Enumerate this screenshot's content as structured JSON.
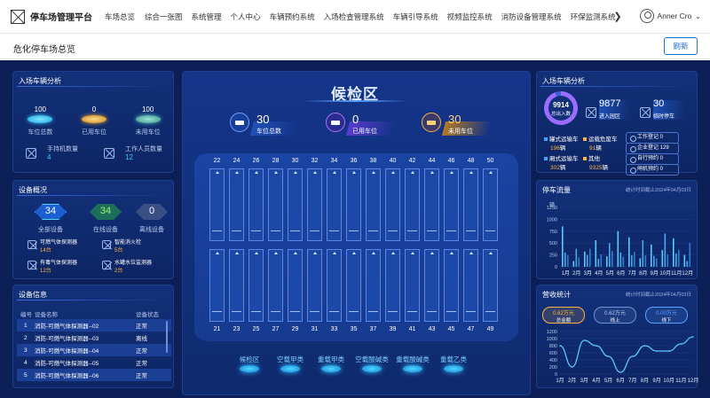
{
  "app_title": "停车场管理平台",
  "nav": [
    "车场总览",
    "综合一张图",
    "系统管理",
    "个人中心",
    "车辆预约系统",
    "入场检查管理系统",
    "车辆引导系统",
    "视频监控系统",
    "消防设备管理系统",
    "环保监测系统"
  ],
  "nav_more": "❯",
  "user": {
    "name": "Anner Cro",
    "dropdown": "⌄"
  },
  "page_title": "危化停车场总览",
  "refresh_label": "刷新",
  "entry_left": {
    "title": "入场车辆分析",
    "stats": [
      {
        "value": "100",
        "label": "车位总数"
      },
      {
        "value": "0",
        "label": "已用车位"
      },
      {
        "value": "100",
        "label": "未用车位"
      }
    ],
    "cards": [
      {
        "label": "手持机数量",
        "value": "4"
      },
      {
        "label": "工作人员数量",
        "value": "12"
      }
    ]
  },
  "equip": {
    "title": "设备概况",
    "stats": [
      {
        "value": "34",
        "label": "全部设备"
      },
      {
        "value": "34",
        "label": "在线设备"
      },
      {
        "value": "0",
        "label": "离线设备"
      }
    ],
    "items": [
      {
        "name": "可燃气体探测器",
        "count": "14台"
      },
      {
        "name": "智能消火栓",
        "count": "5台"
      },
      {
        "name": "有毒气体探测器",
        "count": "12台"
      },
      {
        "name": "水罐水位监测器",
        "count": "2台"
      }
    ]
  },
  "devinfo": {
    "title": "设备信息",
    "headers": [
      "编号",
      "设备名称",
      "设备状态"
    ],
    "rows": [
      [
        "1",
        "消防-可燃气体探测器--02",
        "正常"
      ],
      [
        "2",
        "消防-可燃气体探测器--03",
        "离线"
      ],
      [
        "3",
        "消防-可燃气体探测器--04",
        "正常"
      ],
      [
        "4",
        "消防-可燃气体探测器--05",
        "正常"
      ],
      [
        "5",
        "消防-可燃气体探测器--06",
        "正常"
      ]
    ]
  },
  "center": {
    "title": "候检区",
    "stats": [
      {
        "value": "30",
        "label": "车位总数"
      },
      {
        "value": "0",
        "label": "已用车位"
      },
      {
        "value": "30",
        "label": "未用车位"
      }
    ],
    "top_numbers": [
      "22",
      "24",
      "26",
      "28",
      "30",
      "32",
      "34",
      "36",
      "38",
      "40",
      "42",
      "44",
      "46",
      "48",
      "50"
    ],
    "bottom_numbers": [
      "21",
      "23",
      "25",
      "27",
      "29",
      "31",
      "33",
      "35",
      "37",
      "39",
      "41",
      "43",
      "45",
      "47",
      "49"
    ],
    "zones": [
      "候检区",
      "空载甲类",
      "重载甲类",
      "空载酸碱类",
      "重载酸碱类",
      "重载乙类"
    ]
  },
  "entry_right": {
    "title": "入场车辆分析",
    "total": "9914",
    "total_label": "总出入数",
    "in": "9877",
    "in_label": "进入园区",
    "temp": "30",
    "temp_label": "临时停车",
    "legend": [
      {
        "name": "罐式运输车",
        "value": "196",
        "unit": "辆"
      },
      {
        "name": "运载危废车",
        "value": "91",
        "unit": "辆"
      },
      {
        "name": "厢式运输车",
        "value": "302",
        "unit": "辆"
      },
      {
        "name": "其他",
        "value": "9325",
        "unit": "辆"
      }
    ],
    "pills": [
      "工作登记 0",
      "企业登记 129",
      "自行预约 0",
      "闸机预约 0"
    ]
  },
  "flow": {
    "title": "停车流量",
    "note": "统计时间截止2024年04月03日",
    "unit": "辆",
    "yticks": [
      "1250",
      "1000",
      "750",
      "500",
      "250",
      "0"
    ],
    "months": [
      "1月",
      "2月",
      "3月",
      "4月",
      "5月",
      "6月",
      "7月",
      "8月",
      "9月",
      "10月",
      "11月",
      "12月"
    ]
  },
  "revenue": {
    "title": "营收统计",
    "note": "统计时间截止2024年04月03日",
    "pills": [
      {
        "value": "0.62万元",
        "label": "总金额"
      },
      {
        "value": "0.62万元",
        "label": "线上"
      },
      {
        "value": "0.00万元",
        "label": "线下"
      }
    ],
    "yticks": [
      "1200",
      "1000",
      "800",
      "600",
      "400",
      "200",
      "0"
    ],
    "months": [
      "1月",
      "2月",
      "3月",
      "4月",
      "5月",
      "6月",
      "7月",
      "8月",
      "9月",
      "10月",
      "11月",
      "12月"
    ]
  },
  "chart_data": [
    {
      "type": "bar",
      "title": "停车流量",
      "ylabel": "辆",
      "categories": [
        "1月",
        "2月",
        "3月",
        "4月",
        "5月",
        "6月",
        "7月",
        "8月",
        "9月",
        "10月",
        "11月",
        "12月"
      ],
      "series": [
        {
          "values": [
            850,
            120,
            320,
            560,
            220,
            750,
            620,
            180,
            470,
            350,
            600,
            250
          ]
        },
        {
          "values": [
            300,
            380,
            250,
            170,
            500,
            300,
            240,
            560,
            230,
            700,
            280,
            120
          ]
        },
        {
          "values": [
            240,
            200,
            380,
            260,
            330,
            210,
            310,
            240,
            180,
            260,
            360,
            500
          ]
        }
      ],
      "ylim": [
        0,
        1250
      ]
    },
    {
      "type": "line",
      "title": "营收统计",
      "categories": [
        "1月",
        "2月",
        "3月",
        "4月",
        "5月",
        "6月",
        "7月",
        "8月",
        "9月",
        "10月",
        "11月",
        "12月"
      ],
      "values": [
        800,
        200,
        950,
        800,
        500,
        50,
        500,
        800,
        650,
        650,
        850,
        1050
      ],
      "ylim": [
        0,
        1200
      ]
    }
  ]
}
